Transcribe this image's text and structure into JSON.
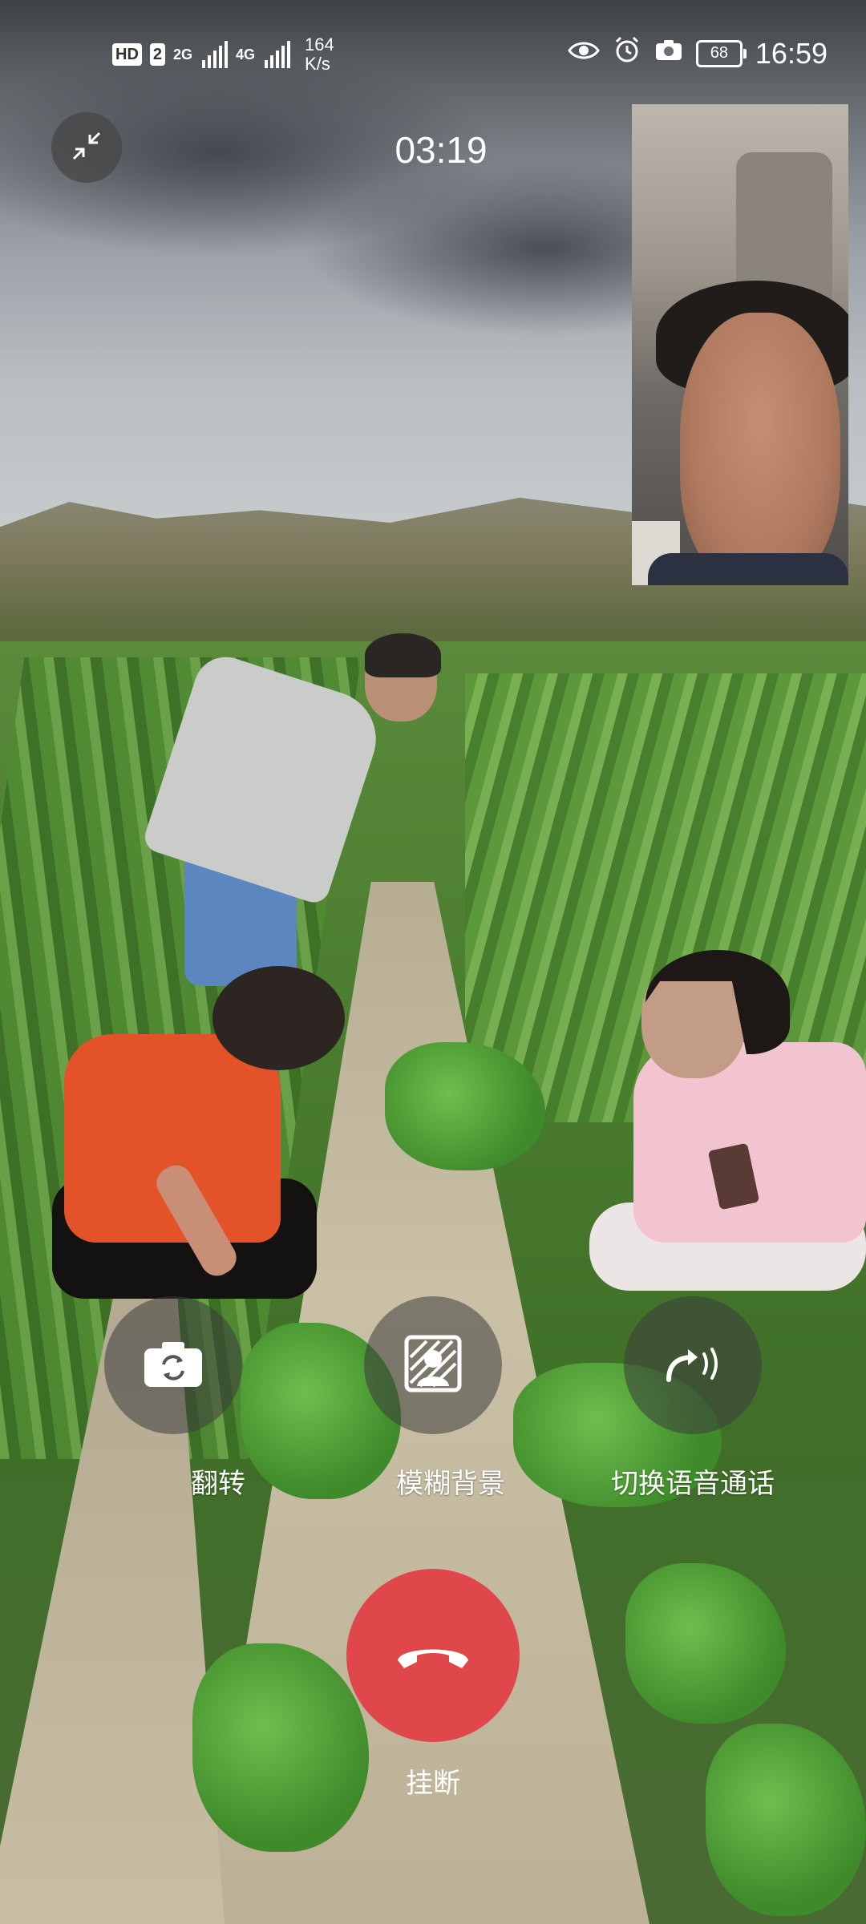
{
  "status_bar": {
    "hd_badge": "HD",
    "sim_badge": "2",
    "net1": "2G",
    "net2": "4G",
    "speed_value": "164",
    "speed_unit": "K/s",
    "battery": "68",
    "time": "16:59",
    "icons": [
      "eye-icon",
      "alarm-icon",
      "camera-icon",
      "battery-icon"
    ]
  },
  "call": {
    "timer": "03:19"
  },
  "controls": {
    "flip_label": "翻转",
    "blur_label": "模糊背景",
    "voice_label": "切换语音通话",
    "hangup_label": "挂断"
  },
  "colors": {
    "hangup": "#e0474a",
    "control_bg": "rgba(60,60,60,0.55)"
  }
}
